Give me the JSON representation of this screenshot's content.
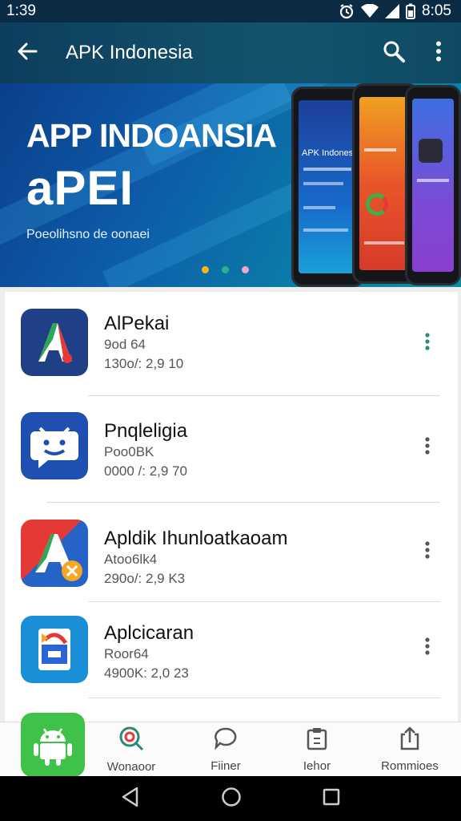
{
  "status_bar": {
    "time_left": "1:39",
    "time_right": "8:05"
  },
  "app_bar": {
    "title": "APK Indonesia",
    "back_icon": "arrow-left-icon",
    "search_icon": "search-icon",
    "more_icon": "more-vert-icon"
  },
  "banner": {
    "title": "APP INDOANSIA",
    "subtitle": "aPEI",
    "caption": "Poeolihsno de oonaei",
    "phone_screen_text": "APK Indonesia",
    "dots": [
      "#f5b51b",
      "#27b48a",
      "#f0a6c8"
    ]
  },
  "apps": [
    {
      "name": "AlPekai",
      "size": "9od 64",
      "meta": "130o/: 2,9 10",
      "icon": "red-a-icon"
    },
    {
      "name": "Pnqleligia",
      "size": "Poo0BK",
      "meta": "0000 /: 2,9 70",
      "icon": "chat-face-icon"
    },
    {
      "name": "Apldik Ihunloatkaoam",
      "size": "Atoo6lk4",
      "meta": "290o/: 2,9 K3",
      "icon": "blue-a-icon"
    },
    {
      "name": "Aplcicaran",
      "size": "Roor64",
      "meta": "4900K: 2,0 23",
      "icon": "document-g-icon"
    }
  ],
  "bottom_nav": {
    "items": [
      {
        "label": "Wonaoor",
        "icon": "magnify-target-icon"
      },
      {
        "label": "Fiiner",
        "icon": "chat-bubble-icon"
      },
      {
        "label": "Iehor",
        "icon": "clipboard-icon"
      },
      {
        "label": "Rommioes",
        "icon": "share-box-icon"
      }
    ]
  },
  "colors": {
    "accent": "#0e3d5e",
    "more_dots": "#2a8a78",
    "android": "#3ec24a"
  }
}
